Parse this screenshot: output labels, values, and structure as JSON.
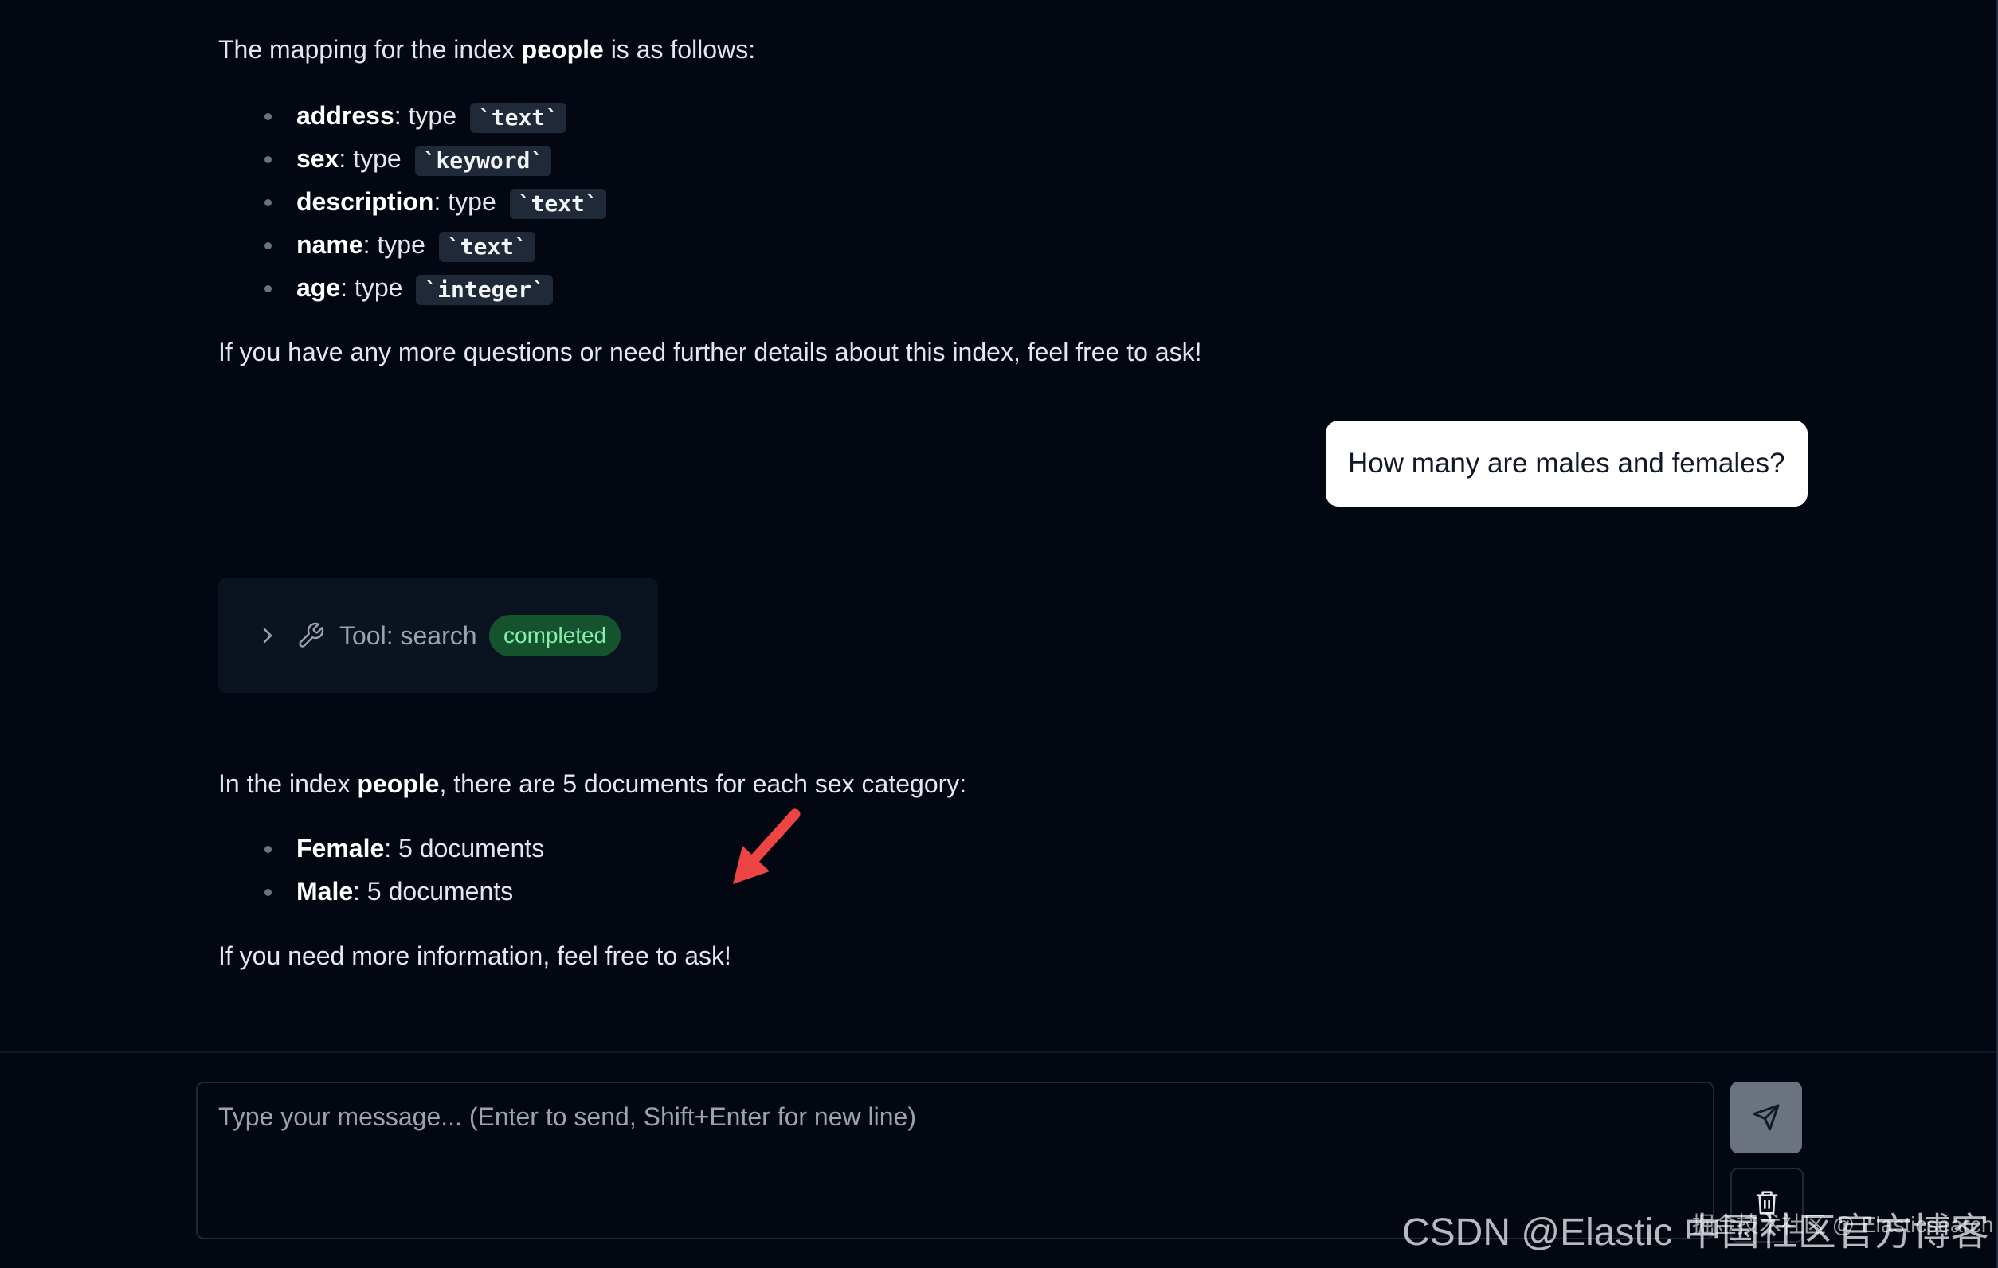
{
  "messages": {
    "mapping_intro": {
      "prefix": "The mapping for the index ",
      "index": "people",
      "suffix": " is as follows:"
    },
    "mapping_fields": [
      {
        "name": "address",
        "sep": ": type ",
        "type": "`text`"
      },
      {
        "name": "sex",
        "sep": ": type ",
        "type": "`keyword`"
      },
      {
        "name": "description",
        "sep": ": type ",
        "type": "`text`"
      },
      {
        "name": "name",
        "sep": ": type ",
        "type": "`text`"
      },
      {
        "name": "age",
        "sep": ": type ",
        "type": "`integer`"
      }
    ],
    "mapping_outro": "If you have any more questions or need further details about this index, feel free to ask!",
    "user_question": "How many are males and females?",
    "tool": {
      "label": "Tool: search",
      "status": "completed"
    },
    "answer_intro": {
      "prefix": "In the index ",
      "index": "people",
      "suffix": ", there are 5 documents for each sex category:"
    },
    "answer_items": [
      {
        "name": "Female",
        "value": ": 5 documents"
      },
      {
        "name": "Male",
        "value": ": 5 documents"
      }
    ],
    "answer_outro": "If you need more information, feel free to ask!"
  },
  "composer": {
    "placeholder": "Type your message... (Enter to send, Shift+Enter for new line)",
    "send_icon": "send-icon",
    "clear_icon": "trash-icon"
  },
  "watermark": {
    "main": "CSDN @Elastic 中国社区官方博客",
    "overlay": "掘金技术社区 @ Elasticsearch"
  },
  "colors": {
    "background": "#030712",
    "badge_bg": "#14532d",
    "badge_text": "#86efac",
    "arrow": "#ef4444"
  }
}
